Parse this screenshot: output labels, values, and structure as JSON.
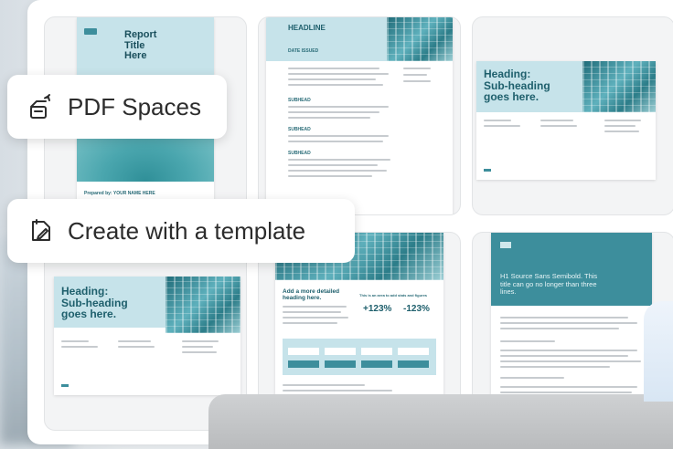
{
  "chips": {
    "pdf_spaces": {
      "label": "PDF Spaces",
      "icon": "pdf-spaces-icon"
    },
    "create_template": {
      "label": "Create with a template",
      "icon": "template-icon"
    }
  },
  "templates": {
    "report": {
      "title_line1": "Report",
      "title_line2": "Title",
      "title_line3": "Here",
      "prepared_by": "Prepared by: YOUR NAME HERE"
    },
    "headline": {
      "headline": "HEADLINE",
      "subhead": "DATE ISSUED",
      "section1": "SUBHEAD",
      "section2": "SUBHEAD",
      "section3": "SUBHEAD"
    },
    "heading_top": {
      "line1": "Heading:",
      "line2": "Sub-heading",
      "line3": "goes here."
    },
    "heading_bottom": {
      "line1": "Heading:",
      "line2": "Sub-heading",
      "line3": "goes here."
    },
    "stats": {
      "heading_line1": "Add a more detailed",
      "heading_line2": "heading here.",
      "side_heading": "This is an area to add stats and figures",
      "stat1": "+123%",
      "stat2": "-123%"
    },
    "h1": {
      "line1": "H1 Source Sans Semibold. This",
      "line2": "title can go no longer than three",
      "line3": "lines."
    }
  },
  "colors": {
    "teal": "#3d8e9c",
    "light_blue": "#c6e3ea",
    "heading_text": "#1e5f6c"
  }
}
